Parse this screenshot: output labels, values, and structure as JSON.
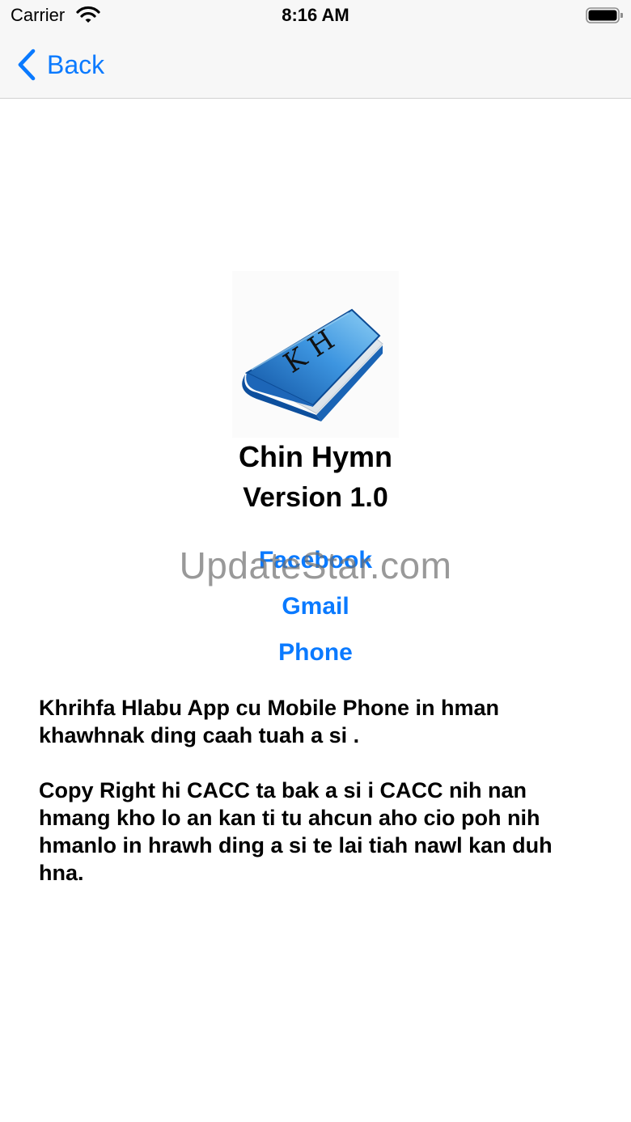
{
  "status_bar": {
    "carrier": "Carrier",
    "time": "8:16 AM",
    "wifi_icon": "wifi-icon",
    "battery_icon": "battery-icon"
  },
  "nav": {
    "back_label": "Back",
    "back_icon": "chevron-left-icon"
  },
  "app": {
    "icon": "book-icon",
    "icon_letters": "K H",
    "name": "Chin Hymn",
    "version": "Version 1.0"
  },
  "links": {
    "facebook": "Facebook",
    "gmail": "Gmail",
    "phone": "Phone"
  },
  "watermark": "UpdateStar.com",
  "description": {
    "paragraph1": "Khrihfa Hlabu App cu Mobile Phone in hman khawhnak ding caah tuah a si .",
    "paragraph2": "Copy Right hi CACC ta bak a si i CACC nih nan hmang kho lo an kan ti tu ahcun aho cio poh nih hmanlo in hrawh ding a si te lai tiah nawl kan duh hna."
  },
  "colors": {
    "accent": "#0a7aff",
    "nav_background": "#f7f7f7",
    "text": "#000000",
    "book_cover": "#2a7fd0"
  }
}
